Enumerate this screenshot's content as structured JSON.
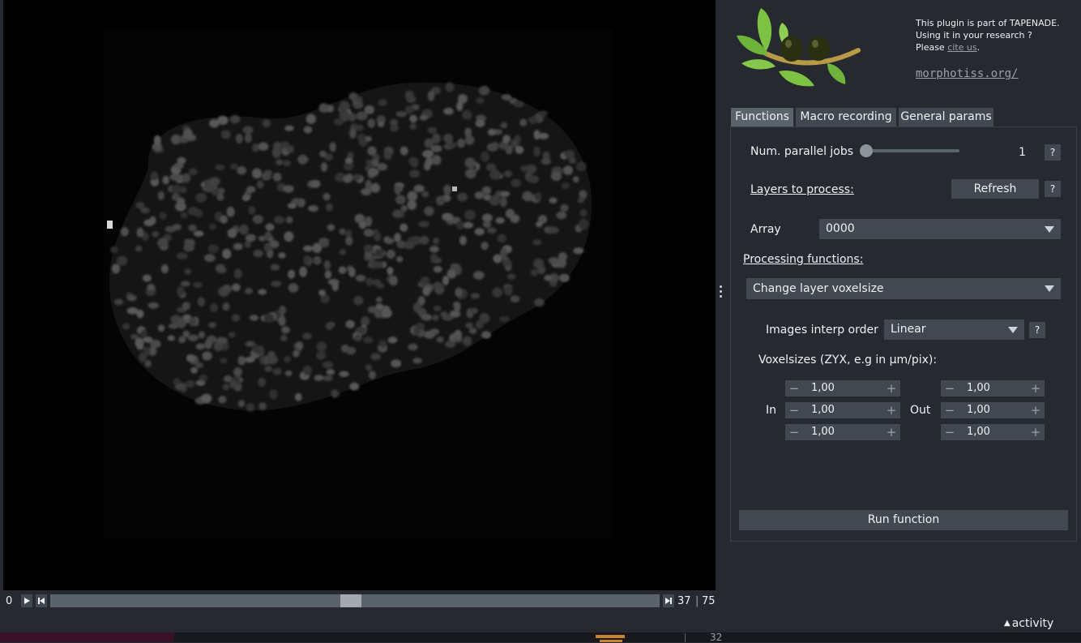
{
  "viewer": {
    "frame_start": "0",
    "current_frame": "37",
    "total_frames": "75",
    "frame_fraction": 0.493,
    "bottom_number": "32"
  },
  "about": {
    "line1": "This plugin is part of TAPENADE.",
    "line2": "Using it in your research ?",
    "please": "Please ",
    "cite_link": "cite us",
    "period": ".",
    "website": "morphotiss.org/"
  },
  "tabs": [
    {
      "label": "Functions",
      "active": true
    },
    {
      "label": "Macro recording",
      "active": false
    },
    {
      "label": "General params",
      "active": false
    }
  ],
  "functions_panel": {
    "parallel_jobs_label": "Num. parallel jobs",
    "parallel_jobs_value": "1",
    "layers_label": "Layers to process:",
    "refresh_label": "Refresh",
    "help_label": "?",
    "array_label": "Array",
    "array_value": "0000",
    "processing_label": "Processing functions:",
    "processing_value": "Change layer voxelsize",
    "interp_label": "Images interp order",
    "interp_value": "Linear",
    "voxelsizes_label": "Voxelsizes (ZYX, e.g in µm/pix):",
    "in_label": "In",
    "out_label": "Out",
    "in_values": [
      "1,00",
      "1,00",
      "1,00"
    ],
    "out_values": [
      "1,00",
      "1,00",
      "1,00"
    ],
    "minus_symbol": "−",
    "plus_symbol": "+",
    "run_label": "Run function"
  },
  "status": {
    "activity_label": "activity",
    "activity_icon": "caret-up-icon"
  },
  "colors": {
    "panel_bg": "#262930",
    "control_bg": "#414851",
    "active_tab": "#5a626c",
    "text": "#f0f1f2"
  }
}
